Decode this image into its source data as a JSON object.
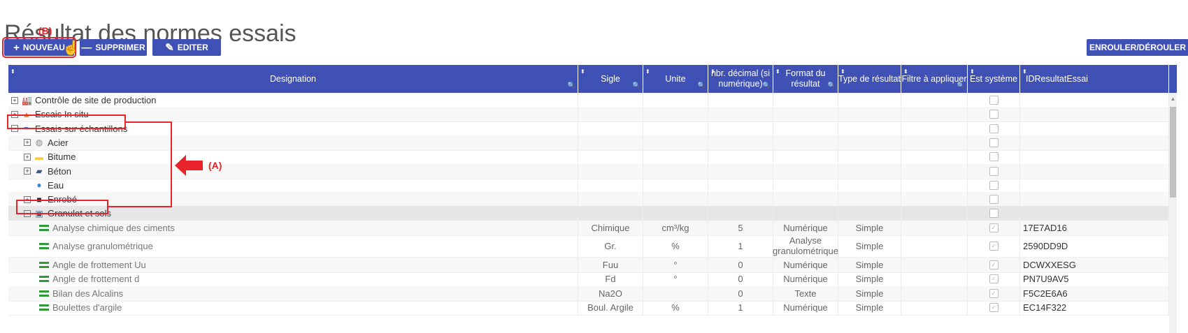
{
  "page": {
    "title": "Résultat des normes essais"
  },
  "toolbar": {
    "new_label": "NOUVEAU",
    "delete_label": "SUPPRIMER",
    "edit_label": "EDITER",
    "rollup_label": "ENROULER/DÉROULER"
  },
  "annotations": {
    "a": "(A)",
    "b": "(B)"
  },
  "columns": [
    {
      "label": "Designation"
    },
    {
      "label": "Sigle"
    },
    {
      "label": "Unite"
    },
    {
      "label": "nbr. décimal (si numérique)"
    },
    {
      "label": "Format du résultat"
    },
    {
      "label": "Type de résultat"
    },
    {
      "label": "Filtre à appliquer"
    },
    {
      "label": "Est système"
    },
    {
      "label": "IDResultatEssai"
    }
  ],
  "tree": [
    {
      "label": "Contrôle de site de production",
      "icon": "factory-icon",
      "expander": "+"
    },
    {
      "label": "Essais In situ",
      "icon": "cone-icon",
      "expander": "+"
    },
    {
      "label": "Essais sur échantillons",
      "icon": "pipette-icon",
      "expander": "−"
    },
    {
      "label": "Acier",
      "icon": "steel-coil-icon",
      "expander": "+"
    },
    {
      "label": "Bitume",
      "icon": "folder-icon",
      "expander": "+"
    },
    {
      "label": "Béton",
      "icon": "concrete-truck-icon",
      "expander": "+"
    },
    {
      "label": "Eau",
      "icon": "water-drop-icon",
      "expander": ""
    },
    {
      "label": "Enrobé",
      "icon": "asphalt-icon",
      "expander": "+"
    },
    {
      "label": "Granulat et sols",
      "icon": "aggregate-icon",
      "expander": "−"
    }
  ],
  "results": [
    {
      "designation": "Analyse chimique des ciments",
      "sigle": "Chimique",
      "unite": "cm³/kg",
      "dec": "5",
      "format": "Numérique",
      "type": "Simple",
      "id": "17E7AD16"
    },
    {
      "designation": "Analyse granulométrique",
      "sigle": "Gr.",
      "unite": "%",
      "dec": "1",
      "format": "Analyse granulométrique",
      "type": "Simple",
      "id": "2590DD9D"
    },
    {
      "designation": "Angle de frottement Uu",
      "sigle": "Fuu",
      "unite": "°",
      "dec": "0",
      "format": "Numérique",
      "type": "Simple",
      "id": "DCWXXESG"
    },
    {
      "designation": "Angle de frottement d",
      "sigle": "Fd",
      "unite": "°",
      "dec": "0",
      "format": "Numérique",
      "type": "Simple",
      "id": "PN7U9AV5"
    },
    {
      "designation": "Bilan des Alcalins",
      "sigle": "Na2O",
      "unite": "",
      "dec": "0",
      "format": "Texte",
      "type": "Simple",
      "id": "F5C2E6A6"
    },
    {
      "designation": "Boulettes d'argile",
      "sigle": "Boul. Argile",
      "unite": "%",
      "dec": "1",
      "format": "Numérique",
      "type": "Simple",
      "id": "EC14F322"
    }
  ],
  "colors": {
    "header": "#3f51b5",
    "annotation": "#e8242a",
    "result_icon": "#2e9b38"
  }
}
